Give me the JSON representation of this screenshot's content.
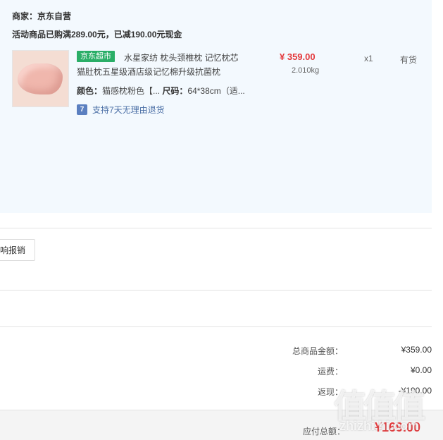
{
  "shop": {
    "merchant": "商家：京东自营",
    "promo": "活动商品已购满289.00元，已减190.00元现金"
  },
  "item": {
    "badge": "京东超市",
    "title_line1": "水星家纺 枕头颈椎枕 记忆枕芯",
    "title_line2": "猫肚枕五星级酒店级记忆棉升级抗菌枕",
    "price": "¥ 359.00",
    "weight": "2.010kg",
    "qty": "x1",
    "stock": "有货",
    "color_label": "颜色：",
    "color_value": "猫感枕粉色【...",
    "size_label": "尺码：",
    "size_value": "64*38cm（适...",
    "return_icon": "7",
    "return_text": "支持7天无理由退货"
  },
  "actions": {
    "reimburse_label": "影响报销"
  },
  "summary": {
    "goods_label": "总商品金额：",
    "goods_value": "¥359.00",
    "shipping_label": "运费：",
    "shipping_value": "¥0.00",
    "rebate_label": "返现：",
    "rebate_value": "-¥190.00",
    "total_label": "应付总额：",
    "total_value": "¥169.00"
  },
  "watermark": {
    "logo": "值值值",
    "url": "zhizhi.hi.com"
  },
  "colors": {
    "panel_bg": "#f3f9fe",
    "price_red": "#e4393c",
    "badge_green": "#2aae67",
    "link_blue": "#4a6ea5"
  },
  "icons": {
    "return_policy": "seven-day-return-icon",
    "product_image": "pillow-thumbnail"
  }
}
